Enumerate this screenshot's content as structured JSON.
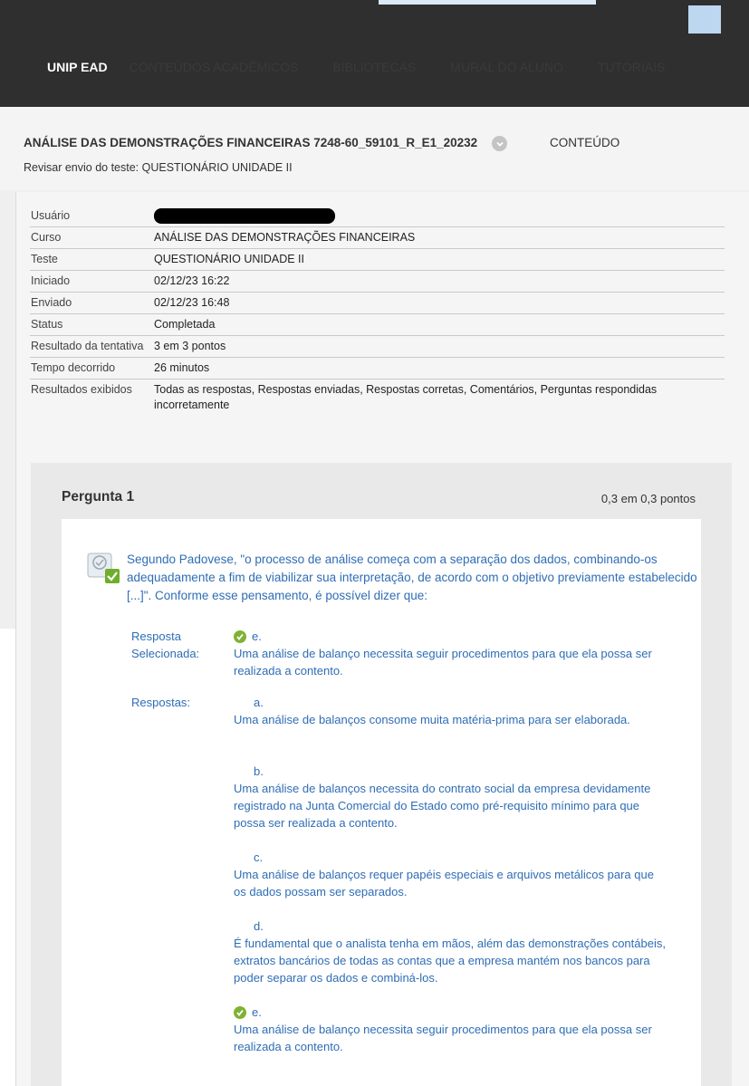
{
  "nav": {
    "brand": "UNIP EAD",
    "items": [
      "CONTEÚDOS ACADÊMICOS",
      "BIBLIOTECAS",
      "MURAL DO ALUNO",
      "TUTORIAIS"
    ]
  },
  "header": {
    "course_title": "ANÁLISE DAS DEMONSTRAÇÕES FINANCEIRAS 7248-60_59101_R_E1_20232",
    "conteudo": "CONTEÚDO",
    "breadcrumb": "Revisar envio do teste: QUESTIONÁRIO UNIDADE II"
  },
  "info": [
    {
      "label": "Usuário",
      "value": ""
    },
    {
      "label": "Curso",
      "value": "ANÁLISE DAS DEMONSTRAÇÕES FINANCEIRAS"
    },
    {
      "label": "Teste",
      "value": "QUESTIONÁRIO UNIDADE II"
    },
    {
      "label": "Iniciado",
      "value": "02/12/23 16:22"
    },
    {
      "label": "Enviado",
      "value": "02/12/23 16:48"
    },
    {
      "label": "Status",
      "value": "Completada"
    },
    {
      "label": "Resultado da tentativa",
      "value": "3 em 3 pontos"
    },
    {
      "label": "Tempo decorrido",
      "value": "26 minutos"
    },
    {
      "label": "Resultados exibidos",
      "value": "Todas as respostas, Respostas enviadas, Respostas corretas, Comentários, Perguntas respondidas incorretamente"
    }
  ],
  "question": {
    "title": "Pergunta 1",
    "points": "0,3 em 0,3 pontos",
    "text": "Segundo Padovese, \"o processo de análise começa com a separação dos dados, combinando-os adequadamente a fim de viabilizar sua interpretação, de acordo com o objetivo previamente estabelecido [...]\". Conforme esse pensamento, é possível dizer que:",
    "selected_label": "Resposta Selecionada:",
    "selected_letter": "e.",
    "selected_text": "Uma análise de balanço necessita seguir procedimentos para que ela possa ser realizada a contento.",
    "answers_label": "Respostas:",
    "answers": [
      {
        "letter": "a.",
        "text": "Uma análise de balanços consome muita matéria-prima para ser elaborada."
      },
      {
        "letter": "b.",
        "text": "Uma análise de balanços necessita do contrato social da empresa devidamente registrado na Junta Comercial do Estado como pré-requisito mínimo para que possa ser realizada a contento."
      },
      {
        "letter": "c.",
        "text": "Uma análise de balanços requer papéis especiais e arquivos metálicos para que os dados possam ser separados."
      },
      {
        "letter": "d.",
        "text": "É fundamental que o analista tenha em mãos, além das demonstrações contábeis, extratos bancários de todas as contas que a empresa mantém nos bancos para poder separar os dados e combiná-los."
      },
      {
        "letter": "e.",
        "text": "Uma análise de balanço necessita seguir procedimentos para que ela possa ser realizada a contento."
      }
    ]
  },
  "colors": {
    "topbar": "#2f2f2f",
    "link": "#2f6db5",
    "check": "#7fb236"
  }
}
